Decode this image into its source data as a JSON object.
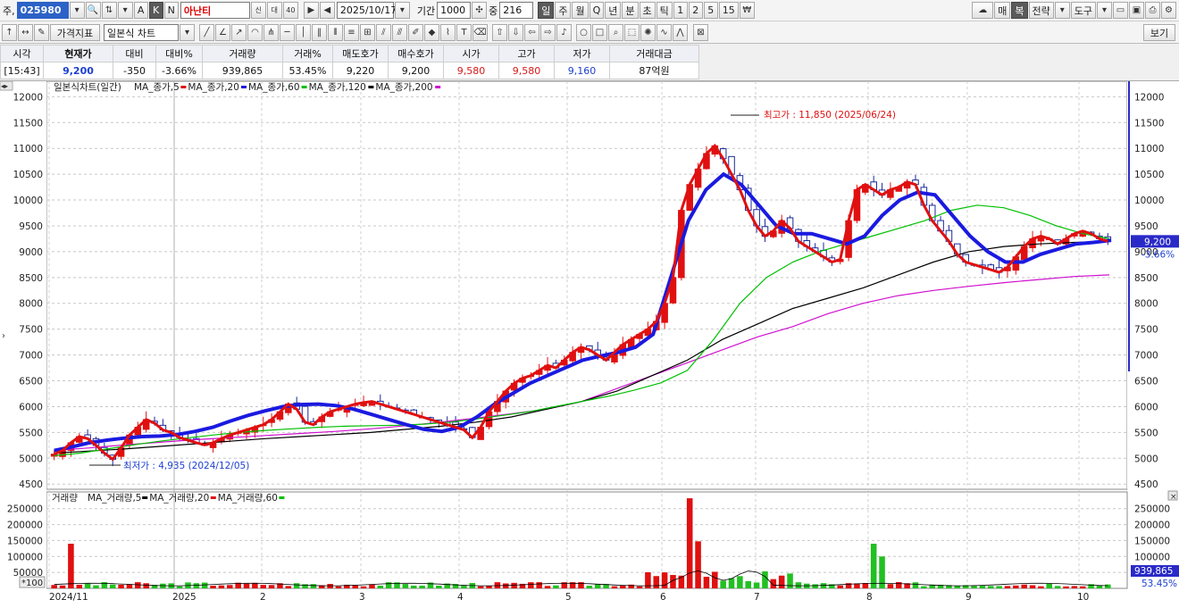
{
  "toolbar": {
    "prefix": "주,",
    "stock_code": "025980",
    "stock_name": "아난티",
    "name_badges": [
      "신",
      "대",
      "40"
    ],
    "mode_buttons": [
      "A",
      "K",
      "N"
    ],
    "date": "2025/10/17",
    "period_label": "기간",
    "period_value": "1000",
    "count_label": "중",
    "count_value": "216",
    "periods": [
      "일",
      "주",
      "월",
      "Q",
      "년",
      "분",
      "초",
      "틱",
      "1",
      "2",
      "5",
      "15"
    ],
    "active_period": "일",
    "right_buttons": [
      "매",
      "복",
      "전략",
      "도구"
    ]
  },
  "toolbar2": {
    "indicator_button": "가격지표",
    "chart_type_select": "일본식 차트",
    "view_button": "보기"
  },
  "quote": {
    "headers": [
      "시각",
      "현재가",
      "대비",
      "대비%",
      "거래량",
      "거래%",
      "매도호가",
      "매수호가",
      "시가",
      "고가",
      "저가",
      "거래대금"
    ],
    "values": [
      "[15:43]",
      "9,200",
      "-350",
      "-3.66%",
      "939,865",
      "53.45%",
      "9,220",
      "9,200",
      "9,580",
      "9,580",
      "9,160",
      "87억원"
    ]
  },
  "chart_data": [
    {
      "type": "candlestick",
      "title": "일본식차트(일간)",
      "legend": [
        {
          "name": "MA_종가,5",
          "color": "#e01010"
        },
        {
          "name": "MA_종가,20",
          "color": "#1a1ae0"
        },
        {
          "name": "MA_종가,60",
          "color": "#00c000"
        },
        {
          "name": "MA_종가,120",
          "color": "#000000"
        },
        {
          "name": "MA_종가,200",
          "color": "#d010d0"
        }
      ],
      "y_ticks": [
        4500,
        5000,
        5500,
        6000,
        6500,
        7000,
        7500,
        8000,
        8500,
        9000,
        9500,
        10000,
        10500,
        11000,
        11500,
        12000
      ],
      "ylim": [
        4400,
        12300
      ],
      "x_ticks": [
        "2024/11",
        "2025",
        "2",
        "3",
        "4",
        "5",
        "6",
        "7",
        "8",
        "9",
        "10"
      ],
      "close_series": [
        5080,
        5150,
        5300,
        5420,
        5380,
        5250,
        5100,
        4980,
        5200,
        5450,
        5600,
        5750,
        5680,
        5550,
        5500,
        5400,
        5350,
        5300,
        5260,
        5300,
        5380,
        5450,
        5500,
        5550,
        5600,
        5650,
        5750,
        5900,
        6050,
        5950,
        5700,
        5650,
        5800,
        5900,
        5950,
        6000,
        6050,
        6080,
        6100,
        6050,
        6000,
        5950,
        5900,
        5850,
        5800,
        5750,
        5700,
        5650,
        5600,
        5550,
        5400,
        5600,
        5900,
        6100,
        6300,
        6450,
        6550,
        6600,
        6700,
        6800,
        6750,
        6900,
        7050,
        7150,
        7100,
        7000,
        6900,
        7050,
        7200,
        7300,
        7400,
        7500,
        7650,
        8000,
        8500,
        9800,
        10300,
        10600,
        10900,
        11050,
        10800,
        10500,
        10200,
        9800,
        9500,
        9300,
        9400,
        9600,
        9450,
        9200,
        9100,
        9000,
        8900,
        8800,
        8850,
        9600,
        10200,
        10300,
        10200,
        10100,
        10200,
        10250,
        10350,
        10300,
        9900,
        9600,
        9400,
        9200,
        8950,
        8800,
        8750,
        8700,
        8650,
        8600,
        8700,
        8900,
        9100,
        9250,
        9300,
        9250,
        9150,
        9250,
        9350,
        9400,
        9350,
        9250,
        9200
      ],
      "ma_lines": {
        "MA_종가,20": [
          5150,
          5220,
          5300,
          5350,
          5390,
          5420,
          5430,
          5460,
          5520,
          5600,
          5720,
          5830,
          5920,
          6000,
          6040,
          6050,
          6020,
          5950,
          5850,
          5750,
          5650,
          5560,
          5520,
          5600,
          5800,
          6050,
          6250,
          6450,
          6600,
          6750,
          6900,
          6980,
          7050,
          7150,
          7400,
          8500,
          9600,
          10200,
          10500,
          10300,
          9900,
          9500,
          9350,
          9350,
          9250,
          9150,
          9300,
          9700,
          10000,
          10150,
          10100,
          9700,
          9300,
          9000,
          8800,
          8800,
          8950,
          9050,
          9150,
          9180,
          9220
        ],
        "MA_종가,60": [
          5050,
          5100,
          5180,
          5260,
          5330,
          5390,
          5450,
          5500,
          5540,
          5570,
          5600,
          5620,
          5630,
          5640,
          5660,
          5700,
          5760,
          5830,
          5900,
          6000,
          6100,
          6200,
          6320,
          6460,
          6700,
          7300,
          8000,
          8500,
          8800,
          9000,
          9150,
          9300,
          9450,
          9600,
          9800,
          9900,
          9850,
          9700,
          9500,
          9350,
          9250
        ],
        "MA_종가,120": [
          5100,
          5140,
          5180,
          5230,
          5280,
          5330,
          5380,
          5420,
          5460,
          5500,
          5560,
          5620,
          5700,
          5800,
          5950,
          6100,
          6300,
          6600,
          6900,
          7300,
          7600,
          7900,
          8100,
          8300,
          8550,
          8800,
          9000,
          9100,
          9150,
          9180,
          9200
        ],
        "MA_종가,200": [
          5150,
          5200,
          5260,
          5310,
          5360,
          5400,
          5440,
          5480,
          5520,
          5570,
          5630,
          5700,
          5780,
          5860,
          5950,
          6100,
          6350,
          6600,
          6850,
          7100,
          7350,
          7550,
          7800,
          8000,
          8150,
          8250,
          8330,
          8400,
          8460,
          8520,
          8550
        ]
      },
      "annotations": [
        {
          "text": "최고가 : 11,850 (2025/06/24)",
          "value": 11850,
          "color": "#e01010"
        },
        {
          "text": "최저가 : 4,935 (2024/12/05)",
          "value": 4935,
          "color": "#1d3fd0"
        }
      ],
      "current_price_label": "9,200",
      "current_change_label": "-3.66%"
    },
    {
      "type": "bar",
      "title": "거래량",
      "legend": [
        {
          "name": "MA_거래량,5",
          "color": "#000000"
        },
        {
          "name": "MA_거래량,20",
          "color": "#e01010"
        },
        {
          "name": "MA_거래량,60",
          "color": "#00c000"
        }
      ],
      "y_ticks": [
        50000,
        100000,
        150000,
        200000,
        250000
      ],
      "ylim": [
        0,
        280000
      ],
      "unit_label": "*100",
      "spikes": [
        {
          "x_label": "2024/11",
          "value": 140000
        },
        {
          "x_label": "6",
          "value": 280000
        },
        {
          "x_label": "6",
          "value": 130000
        },
        {
          "x_label": "8",
          "value": 140000
        },
        {
          "x_label": "8",
          "value": 100000
        }
      ],
      "current_volume_label": "939,865",
      "current_ratio_label": "53.45%"
    }
  ]
}
